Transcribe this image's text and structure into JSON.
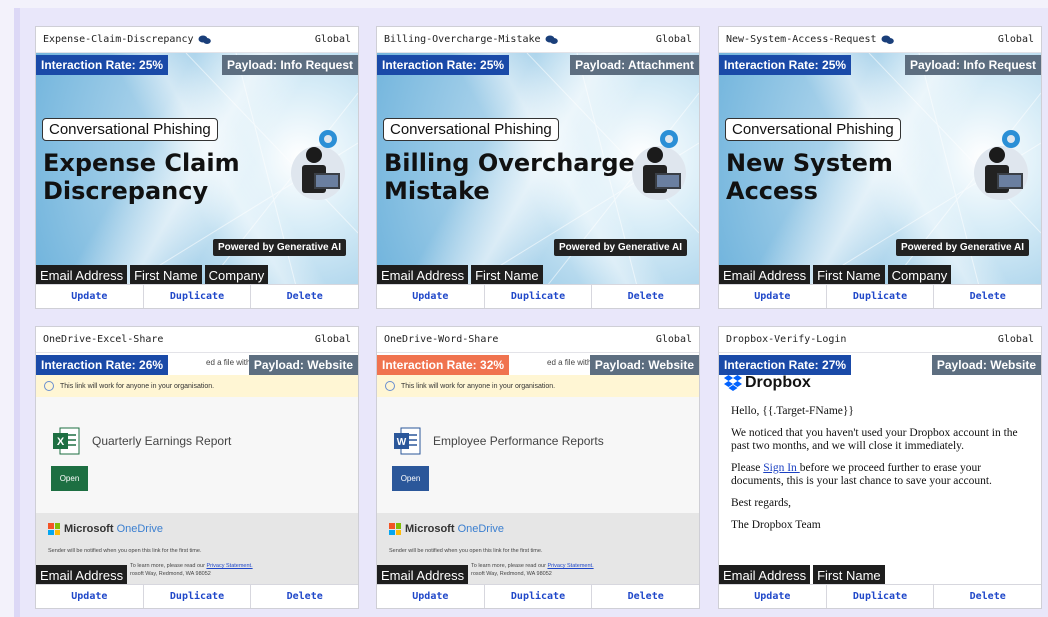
{
  "cards": [
    {
      "title": "Expense-Claim-Discrepancy",
      "scope": "Global",
      "interaction_rate": "Interaction Rate: 25%",
      "payload": "Payload: Info Request",
      "badge": "Conversational Phishing",
      "headline_line1": "Expense Claim",
      "headline_line2": "Discrepancy",
      "powered_by": "Powered by Generative AI",
      "tags": [
        "Email Address",
        "First Name",
        "Company"
      ],
      "actions": {
        "update": "Update",
        "duplicate": "Duplicate",
        "delete": "Delete"
      }
    },
    {
      "title": "Billing-Overcharge-Mistake",
      "scope": "Global",
      "interaction_rate": "Interaction Rate: 25%",
      "payload": "Payload: Attachment",
      "badge": "Conversational Phishing",
      "headline_line1": "Billing Overcharge",
      "headline_line2": "Mistake",
      "powered_by": "Powered by Generative AI",
      "tags": [
        "Email Address",
        "First Name"
      ],
      "actions": {
        "update": "Update",
        "duplicate": "Duplicate",
        "delete": "Delete"
      }
    },
    {
      "title": "New-System-Access-Request",
      "scope": "Global",
      "interaction_rate": "Interaction Rate: 25%",
      "payload": "Payload: Info Request",
      "badge": "Conversational Phishing",
      "headline_line1": "New System",
      "headline_line2": "Access",
      "powered_by": "Powered by Generative AI",
      "tags": [
        "Email Address",
        "First Name",
        "Company"
      ],
      "actions": {
        "update": "Update",
        "duplicate": "Duplicate",
        "delete": "Delete"
      }
    },
    {
      "title": "OneDrive-Excel-Share",
      "scope": "Global",
      "interaction_rate": "Interaction Rate: 26%",
      "payload": "Payload: Website",
      "preview_top": "ed a file with you",
      "notice": "This link will work for anyone in your organisation.",
      "file_name": "Quarterly Earnings Report",
      "open": "Open",
      "brand_ms": "Microsoft",
      "brand_od": "OneDrive",
      "sender_note": "Sender will be notified when you open this link for the first time.",
      "privacy_prefix": "To learn more, please read our ",
      "privacy_link": "Privacy Statement.",
      "address": "rosoft Way, Redmond, WA 98052",
      "tags": [
        "Email Address"
      ],
      "accent": "#1d6f42",
      "actions": {
        "update": "Update",
        "duplicate": "Duplicate",
        "delete": "Delete"
      }
    },
    {
      "title": "OneDrive-Word-Share",
      "scope": "Global",
      "interaction_rate": "Interaction Rate: 32%",
      "payload": "Payload: Website",
      "preview_top": "ed a file with you",
      "notice": "This link will work for anyone in your organisation.",
      "file_name": "Employee Performance Reports",
      "open": "Open",
      "brand_ms": "Microsoft",
      "brand_od": "OneDrive",
      "sender_note": "Sender will be notified when you open this link for the first time.",
      "privacy_prefix": "To learn more, please read our ",
      "privacy_link": "Privacy Statement.",
      "address": "rosoft Way, Redmond, WA 98052",
      "tags": [
        "Email Address"
      ],
      "accent": "#2b579a",
      "actions": {
        "update": "Update",
        "duplicate": "Duplicate",
        "delete": "Delete"
      }
    },
    {
      "title": "Dropbox-Verify-Login",
      "scope": "Global",
      "interaction_rate": "Interaction Rate: 27%",
      "payload": "Payload: Website",
      "brand": "Dropbox",
      "greeting": "Hello, {{.Target-FName}}",
      "para1": "We noticed that you haven't used your Dropbox account in the past two months, and we will close it immediately.",
      "para2_prefix": "Please ",
      "para2_link": "Sign In ",
      "para2_suffix": "before we proceed further to erase your documents, this is your last chance to save your account.",
      "regards": "Best regards,",
      "signature": "The Dropbox Team",
      "tags": [
        "Email Address",
        "First Name"
      ],
      "actions": {
        "update": "Update",
        "duplicate": "Duplicate",
        "delete": "Delete"
      }
    }
  ],
  "colors": {
    "rate_blue": "#1a4aa8",
    "rate_orange": "#f0734f",
    "payload_gray": "#5d6e80",
    "action_blue": "#1f47c9"
  }
}
